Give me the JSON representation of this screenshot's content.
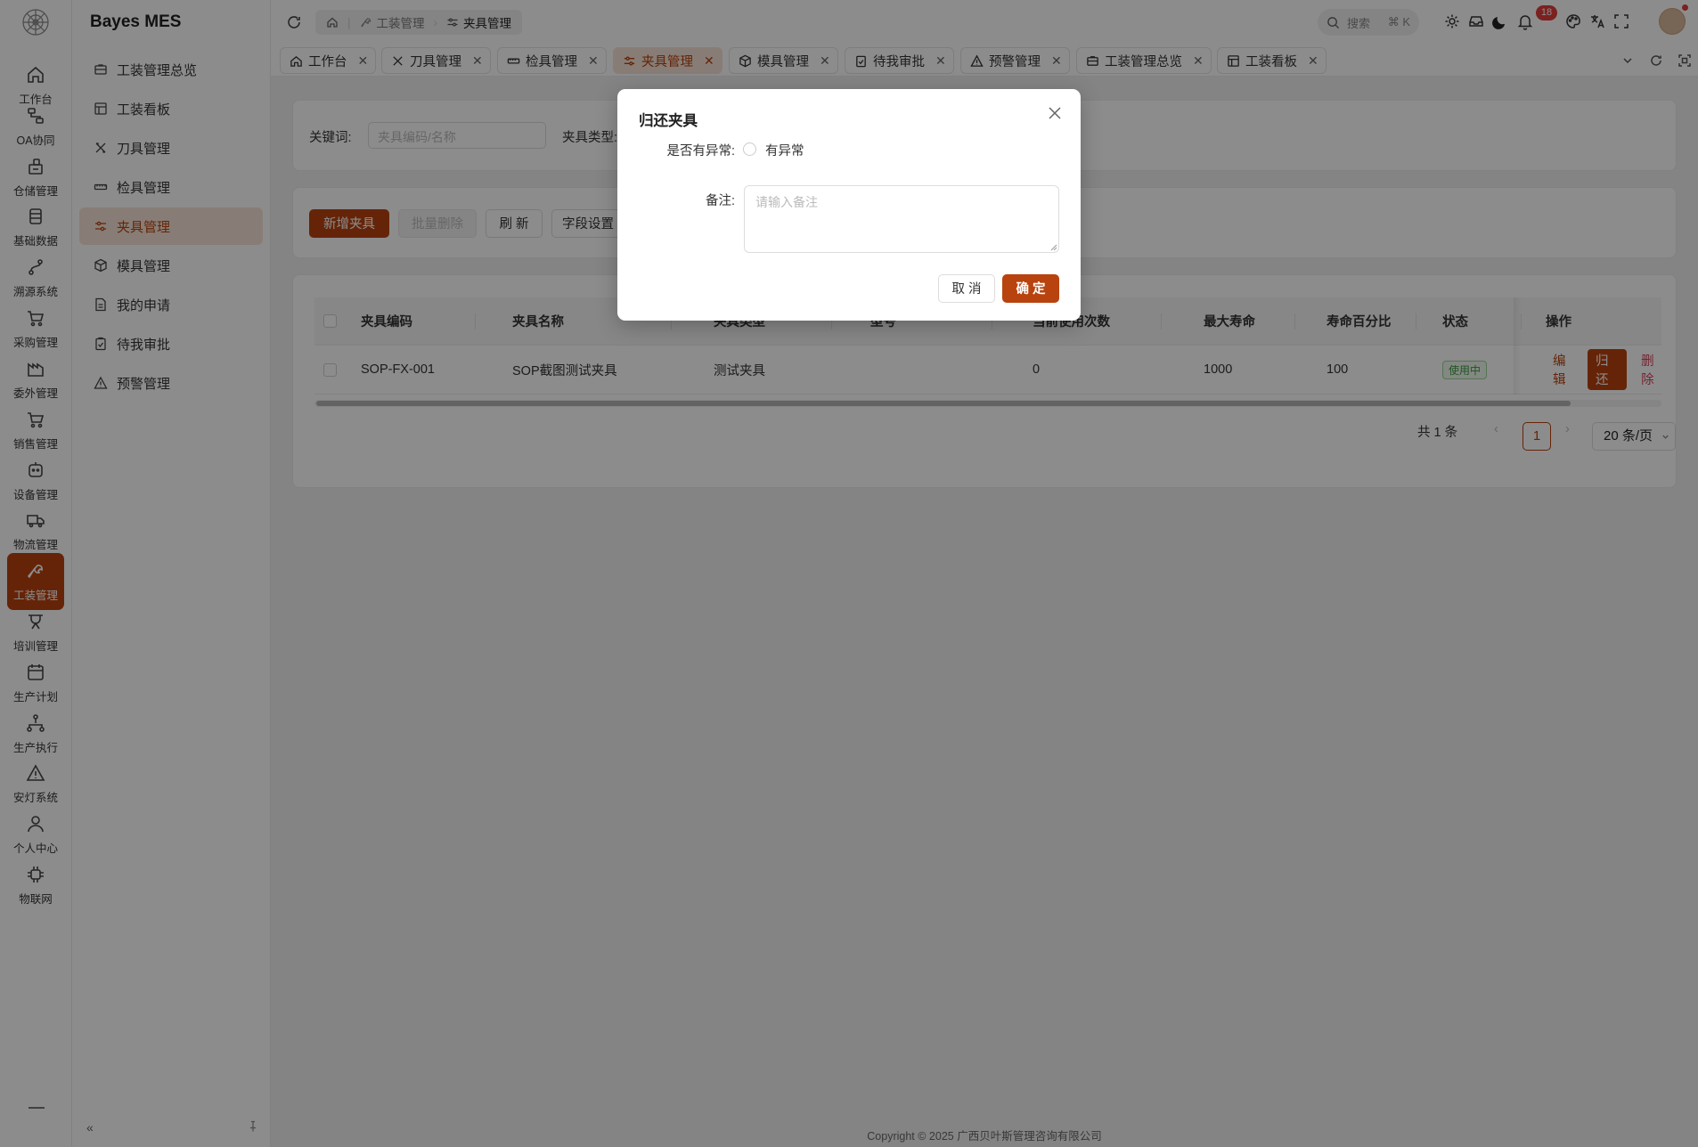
{
  "app": {
    "title": "Bayes MES"
  },
  "rail": {
    "items": [
      {
        "label": "工作台",
        "icon": "home-icon"
      },
      {
        "label": "OA协同",
        "icon": "flow-icon"
      },
      {
        "label": "仓储管理",
        "icon": "warehouse-icon"
      },
      {
        "label": "基础数据",
        "icon": "database-icon"
      },
      {
        "label": "溯源系统",
        "icon": "route-icon"
      },
      {
        "label": "采购管理",
        "icon": "cart-icon"
      },
      {
        "label": "委外管理",
        "icon": "factory-icon"
      },
      {
        "label": "销售管理",
        "icon": "shop-cart-icon"
      },
      {
        "label": "设备管理",
        "icon": "device-icon"
      },
      {
        "label": "物流管理",
        "icon": "truck-icon"
      },
      {
        "label": "工装管理",
        "icon": "wrench-icon"
      },
      {
        "label": "培训管理",
        "icon": "training-icon"
      },
      {
        "label": "生产计划",
        "icon": "calendar-icon"
      },
      {
        "label": "生产执行",
        "icon": "network-icon"
      },
      {
        "label": "安灯系统",
        "icon": "warning-icon"
      },
      {
        "label": "个人中心",
        "icon": "user-icon"
      },
      {
        "label": "物联网",
        "icon": "chip-icon"
      }
    ],
    "active_index": 10
  },
  "sidebar": {
    "items": [
      {
        "label": "工装管理总览",
        "icon": "briefcase-icon"
      },
      {
        "label": "工装看板",
        "icon": "dashboard-icon"
      },
      {
        "label": "刀具管理",
        "icon": "tools-icon"
      },
      {
        "label": "检具管理",
        "icon": "ruler-icon"
      },
      {
        "label": "夹具管理",
        "icon": "sliders-icon"
      },
      {
        "label": "模具管理",
        "icon": "box-icon"
      },
      {
        "label": "我的申请",
        "icon": "file-icon"
      },
      {
        "label": "待我审批",
        "icon": "clipboard-check-icon"
      },
      {
        "label": "预警管理",
        "icon": "warning-icon"
      }
    ],
    "active_index": 4
  },
  "header": {
    "breadcrumb": [
      "工装管理",
      "夹具管理"
    ],
    "search_placeholder": "搜索",
    "search_shortcut": "⌘ K",
    "notification_count": "18"
  },
  "tabs": [
    {
      "label": "工作台",
      "icon": "home-icon"
    },
    {
      "label": "刀具管理",
      "icon": "tools-icon"
    },
    {
      "label": "检具管理",
      "icon": "ruler-icon"
    },
    {
      "label": "夹具管理",
      "icon": "sliders-icon",
      "active": true
    },
    {
      "label": "模具管理",
      "icon": "box-icon"
    },
    {
      "label": "待我审批",
      "icon": "clipboard-check-icon"
    },
    {
      "label": "预警管理",
      "icon": "warning-icon"
    },
    {
      "label": "工装管理总览",
      "icon": "briefcase-icon"
    },
    {
      "label": "工装看板",
      "icon": "dashboard-icon"
    }
  ],
  "filter": {
    "keyword_label": "关键词:",
    "keyword_placeholder": "夹具编码/名称",
    "type_label": "夹具类型:"
  },
  "toolbar": {
    "add_label": "新增夹具",
    "batch_delete_label": "批量删除",
    "refresh_label": "刷 新",
    "fields_label": "字段设置"
  },
  "table": {
    "columns": [
      "夹具编码",
      "夹具名称",
      "夹具类型",
      "型号",
      "当前使用次数",
      "最大寿命",
      "寿命百分比",
      "状态",
      "操作"
    ],
    "rows": [
      {
        "code": "SOP-FX-001",
        "name": "SOP截图测试夹具",
        "type": "测试夹具",
        "model": "",
        "use_count": "0",
        "max_life": "1000",
        "life_pct": "100",
        "status": "使用中"
      }
    ],
    "actions": {
      "edit": "编辑",
      "return": "归 还",
      "delete": "删除"
    }
  },
  "pagination": {
    "total": "共 1 条",
    "current": "1",
    "page_size": "20 条/页"
  },
  "footer": {
    "copyright": "Copyright © 2025 广西贝叶斯管理咨询有限公司"
  },
  "modal": {
    "title": "归还夹具",
    "abnormal_label": "是否有异常:",
    "abnormal_option": "有异常",
    "remark_label": "备注:",
    "remark_placeholder": "请输入备注",
    "cancel_label": "取 消",
    "confirm_label": "确 定"
  },
  "colors": {
    "accent": "#b8430f",
    "accent_light": "#f6e3d7",
    "danger": "#d4455e",
    "success": "#3c9a3c"
  }
}
